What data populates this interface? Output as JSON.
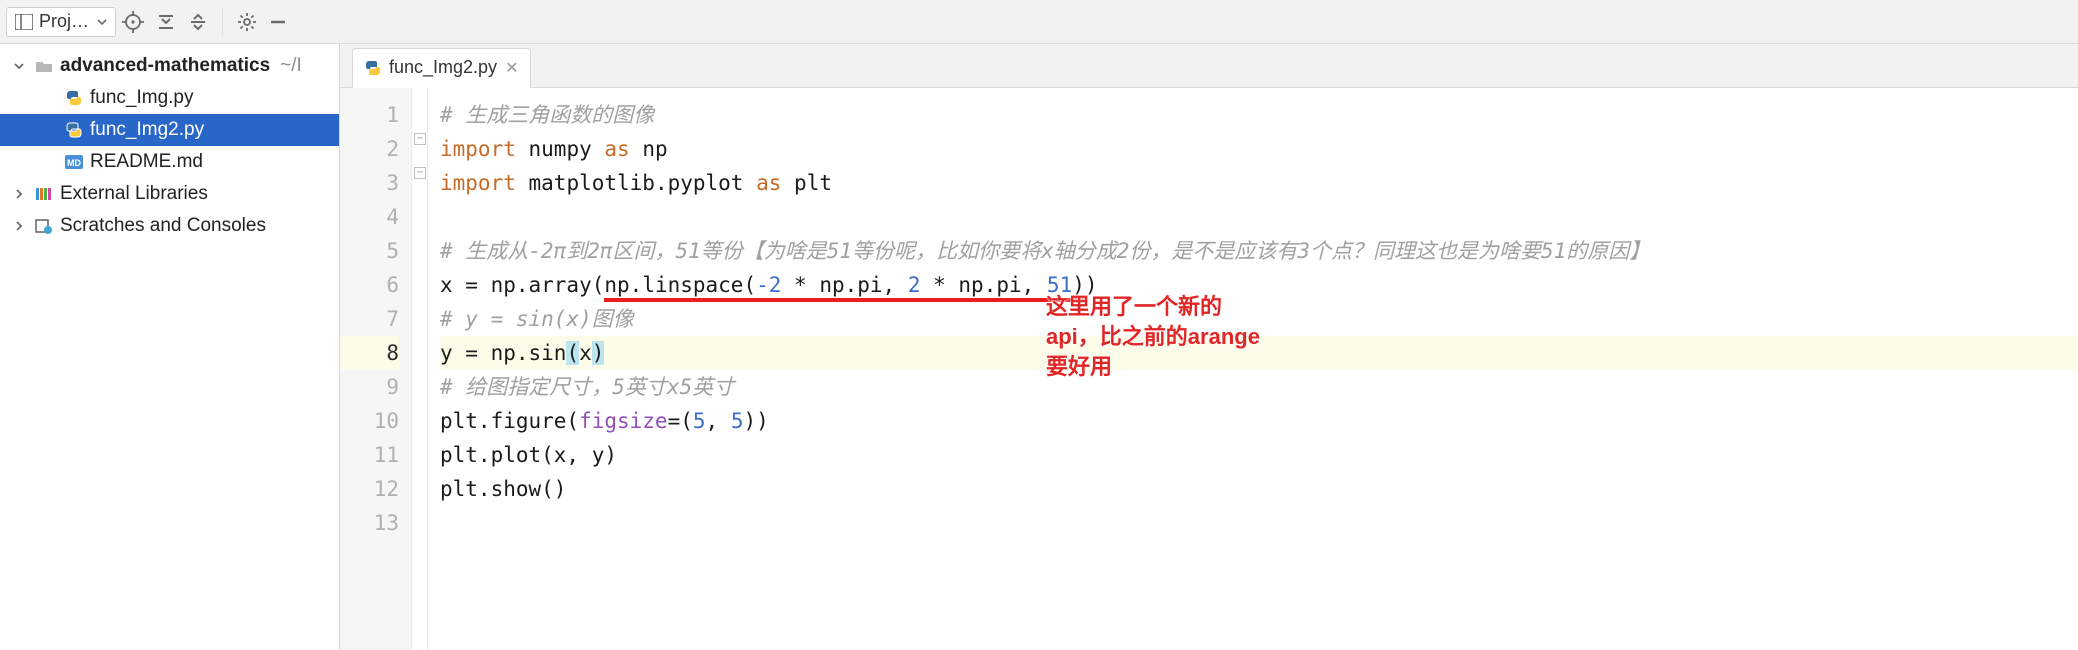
{
  "toolbar": {
    "project_label": "Proj…"
  },
  "tree": {
    "root": {
      "name": "advanced-mathematics",
      "suffix": "~/I"
    },
    "files": [
      {
        "name": "func_Img.py",
        "kind": "py",
        "selected": false
      },
      {
        "name": "func_Img2.py",
        "kind": "py",
        "selected": true
      },
      {
        "name": "README.md",
        "kind": "md",
        "selected": false
      }
    ],
    "external": "External Libraries",
    "scratches": "Scratches and Consoles"
  },
  "tab": {
    "label": "func_Img2.py"
  },
  "code": {
    "lines": [
      {
        "n": 1,
        "type": "comment",
        "raw": "# 生成三角函数的图像"
      },
      {
        "n": 2,
        "type": "import1",
        "kw1": "import",
        "mod": "numpy",
        "kw2": "as",
        "alias": "np"
      },
      {
        "n": 3,
        "type": "import1",
        "kw1": "import",
        "mod": "matplotlib.pyplot",
        "kw2": "as",
        "alias": "plt"
      },
      {
        "n": 4,
        "type": "blank"
      },
      {
        "n": 5,
        "type": "comment",
        "raw": "# 生成从-2π到2π区间，51等份【为啥是51等份呢，比如你要将x轴分成2份，是不是应该有3个点？同理这也是为啥要51的原因】"
      },
      {
        "n": 6,
        "type": "linspace",
        "pre": "x = np.array(",
        "under_pre": "np.linspace(",
        "neg2": "-2",
        "mid1": " * np.pi, ",
        "pos2": "2",
        "mid2": " * np.pi, ",
        "fiftyone": "51",
        "under_post": ")",
        "post": ")"
      },
      {
        "n": 7,
        "type": "comment",
        "raw": "# y = sin(x)图像"
      },
      {
        "n": 8,
        "type": "sin",
        "pre": "y = np.sin",
        "lp": "(",
        "x": "x",
        "rp": ")"
      },
      {
        "n": 9,
        "type": "comment",
        "raw": "# 给图指定尺寸，5英寸x5英寸"
      },
      {
        "n": 10,
        "type": "figure",
        "pre": "plt.figure(",
        "kw": "figsize",
        "mid": "=(",
        "a": "5",
        "comma": ", ",
        "b": "5",
        "post": "))"
      },
      {
        "n": 11,
        "type": "plain",
        "raw": "plt.plot(x, y)"
      },
      {
        "n": 12,
        "type": "plain",
        "raw": "plt.show()"
      },
      {
        "n": 13,
        "type": "blank"
      }
    ],
    "current_line": 8
  },
  "annotation": {
    "l1": "这里用了一个新的",
    "l2": "api，比之前的arange",
    "l3": "要好用"
  }
}
